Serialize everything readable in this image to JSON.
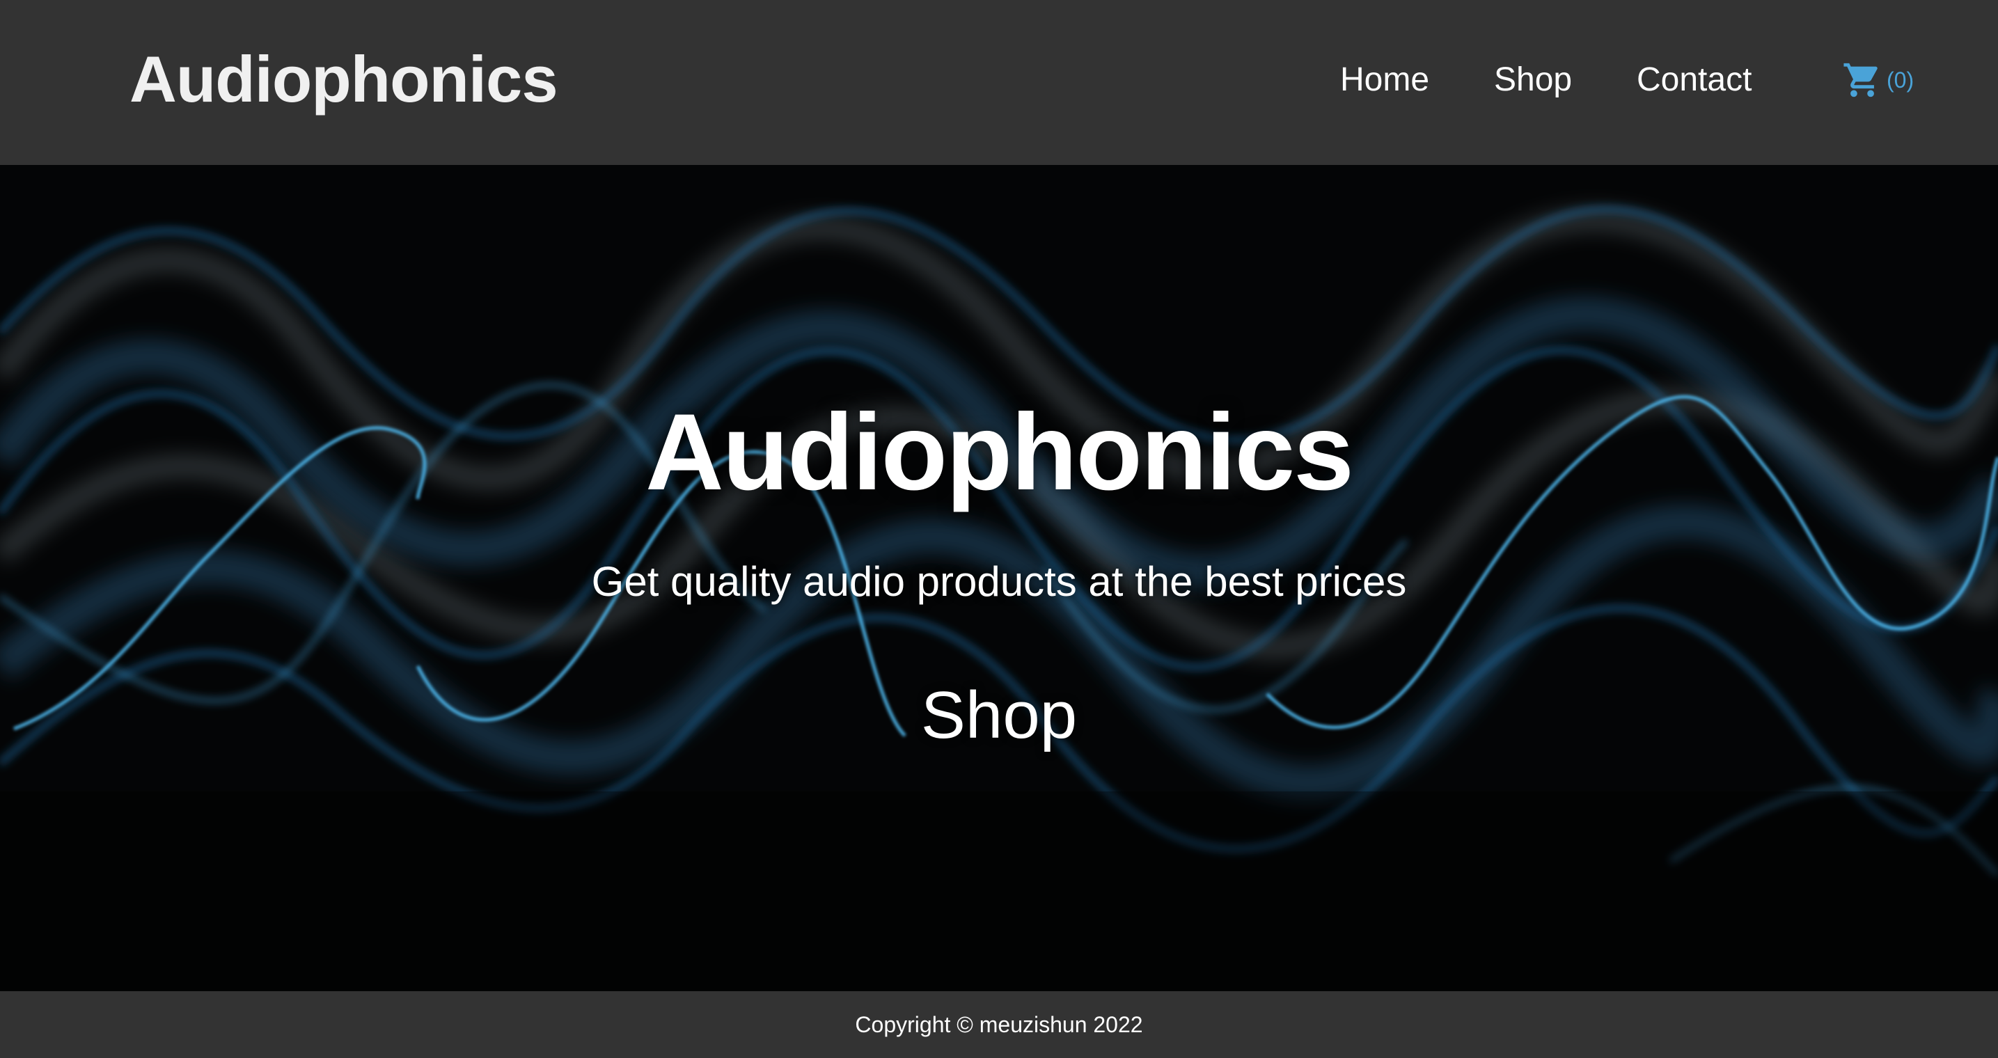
{
  "header": {
    "brand": "Audiophonics",
    "nav": {
      "home": "Home",
      "shop": "Shop",
      "contact": "Contact"
    },
    "cart": {
      "icon": "cart-icon",
      "count": "(0)",
      "color": "#4aa3d8"
    },
    "background": "#333333"
  },
  "hero": {
    "title": "Audiophonics",
    "subtitle": "Get quality audio products at the best prices",
    "cta": "Shop",
    "background_image": "blue sound waves on black"
  },
  "footer": {
    "text": "Copyright © meuzishun 2022",
    "background": "#333333"
  }
}
